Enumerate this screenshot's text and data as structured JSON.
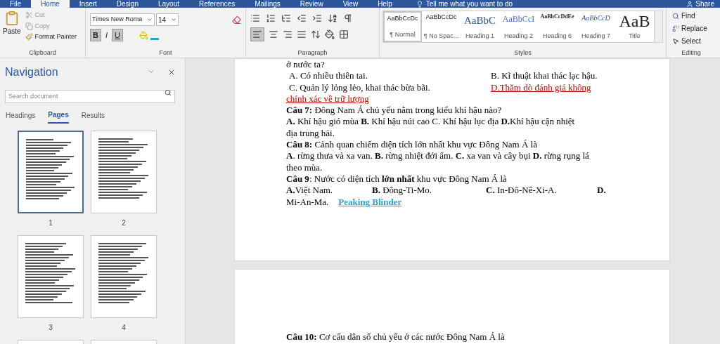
{
  "menu_tabs": [
    {
      "label": "File",
      "selected": false
    },
    {
      "label": "Home",
      "selected": true
    },
    {
      "label": "Insert",
      "selected": false
    },
    {
      "label": "Design",
      "selected": false
    },
    {
      "label": "Layout",
      "selected": false
    },
    {
      "label": "References",
      "selected": false
    },
    {
      "label": "Mailings",
      "selected": false
    },
    {
      "label": "Review",
      "selected": false
    },
    {
      "label": "View",
      "selected": false
    },
    {
      "label": "Help",
      "selected": false
    }
  ],
  "tell_me": "Tell me what you want to do",
  "share": "Share",
  "clipboard": {
    "paste": "Paste",
    "cut": "Cut",
    "copy": "Copy",
    "format_painter": "Format Painter",
    "label": "Clipboard"
  },
  "font": {
    "name": "Times New Roma",
    "size": "14",
    "label": "Font",
    "bold_glyph": "B",
    "italic_glyph": "I",
    "underline_glyph": "U",
    "bold": true,
    "italic": false,
    "underline": true
  },
  "paragraph": {
    "label": "Paragraph",
    "align_left": true
  },
  "styles": {
    "label": "Styles",
    "items": [
      {
        "preview": "AaBbCcDc",
        "label": "¶ Normal",
        "kind": "normal",
        "selected": true
      },
      {
        "preview": "AaBbCcDc",
        "label": "¶ No Spac...",
        "kind": "normal",
        "selected": false
      },
      {
        "preview": "AaBbC",
        "label": "Heading 1",
        "kind": "heading",
        "selected": false
      },
      {
        "preview": "AaBbCcI",
        "label": "Heading 2",
        "kind": "subheading",
        "selected": false
      },
      {
        "preview": "AaBbCcDdEe",
        "label": "Heading 6",
        "kind": "bold",
        "selected": false
      },
      {
        "preview": "AaBbCcD",
        "label": "Heading 7",
        "kind": "italic",
        "selected": false
      },
      {
        "preview": "AaB",
        "label": "Title",
        "kind": "title",
        "selected": false
      }
    ]
  },
  "editing": {
    "label": "Editing",
    "find": "Find",
    "replace": "Replace",
    "select": "Select"
  },
  "navigation": {
    "title": "Navigation",
    "search_placeholder": "Search document",
    "tabs": [
      {
        "label": "Headings",
        "selected": false
      },
      {
        "label": "Pages",
        "selected": true
      },
      {
        "label": "Results",
        "selected": false
      }
    ],
    "pages": [
      {
        "label": "1",
        "selected": true
      },
      {
        "label": "2",
        "selected": false
      },
      {
        "label": "3",
        "selected": false
      },
      {
        "label": "4",
        "selected": false
      },
      {
        "selected": false
      },
      {
        "selected": false
      }
    ]
  },
  "document": {
    "pages": [
      {
        "lines": [
          {
            "cells": [
              {
                "text": "ở nước ta?",
                "kind": "plain"
              }
            ]
          },
          {
            "cells": [
              {
                "text": "A. Có nhiều thiên tai.",
                "kind": "plain"
              },
              {
                "text": "B. Kĩ thuật khai thác lạc hậu.",
                "kind": "plain"
              }
            ]
          },
          {
            "cells": [
              {
                "text": "C. Quản lý lỏng lẻo, khai thác bừa bãi.",
                "kind": "plain"
              },
              {
                "text": "D.Thăm dò đánh giá không",
                "kind": "answer"
              }
            ]
          },
          {
            "cells": [
              {
                "text": "chính xác về trữ lượng",
                "kind": "answer"
              }
            ]
          },
          {
            "cells": [
              {
                "text": "**Câu 7:**  Đông Nam Á  chủ yếu nằm trong kiểu khí hậu nào?",
                "kind": "plain"
              }
            ]
          },
          {
            "cells": [
              {
                "text": "**A.** Khí hậu gió mùa  **B.** Khí hậu núi cao   C. Khí hậu lục địa  **D.**Khí hậu  cận nhiệt",
                "kind": "plain"
              }
            ]
          },
          {
            "cells": [
              {
                "text": "địa trung hải.",
                "kind": "plain"
              }
            ]
          },
          {
            "cells": [
              {
                "text": "**Câu 8:** Cảnh quan chiếm diện tích lớn nhất khu vực Đông Nam Á là",
                "kind": "plain"
              }
            ]
          },
          {
            "cells": [
              {
                "text": "**A**. rừng thưa và xa van. **B.** rừng nhiệt  đới ẩm. **C.** xa van và cây bụi  **D.** rừng rụng lá",
                "kind": "plain"
              }
            ]
          },
          {
            "cells": [
              {
                "text": "theo mùa.",
                "kind": "plain"
              }
            ]
          },
          {
            "cells": [
              {
                "text": "**Câu 9**: Nước có diện tích **lớn nhất** khu vực Đông Nam Á là",
                "kind": "plain"
              }
            ]
          },
          {
            "cells": [
              {
                "text": "**A.**Việt Nam.",
                "kind": "plain"
              },
              {
                "text": "**B.** Đông-Ti-Mo.",
                "kind": "plain"
              },
              {
                "text": "**C.** In-Đô-Nê-Xi-A.",
                "kind": "plain"
              },
              {
                "text": "**D.**",
                "kind": "plain"
              }
            ]
          },
          {
            "cells": [
              {
                "text": "Mi-An-Ma.",
                "kind": "plain"
              },
              {
                "text": "Peaking Blinder",
                "kind": "link"
              }
            ]
          }
        ]
      },
      {
        "lines": [
          {
            "cells": [
              {
                "text": "**Câu 10:**  Cơ cấu dân số chủ yếu ở các nước Đông Nam Á là",
                "kind": "plain"
              }
            ]
          }
        ]
      }
    ]
  }
}
